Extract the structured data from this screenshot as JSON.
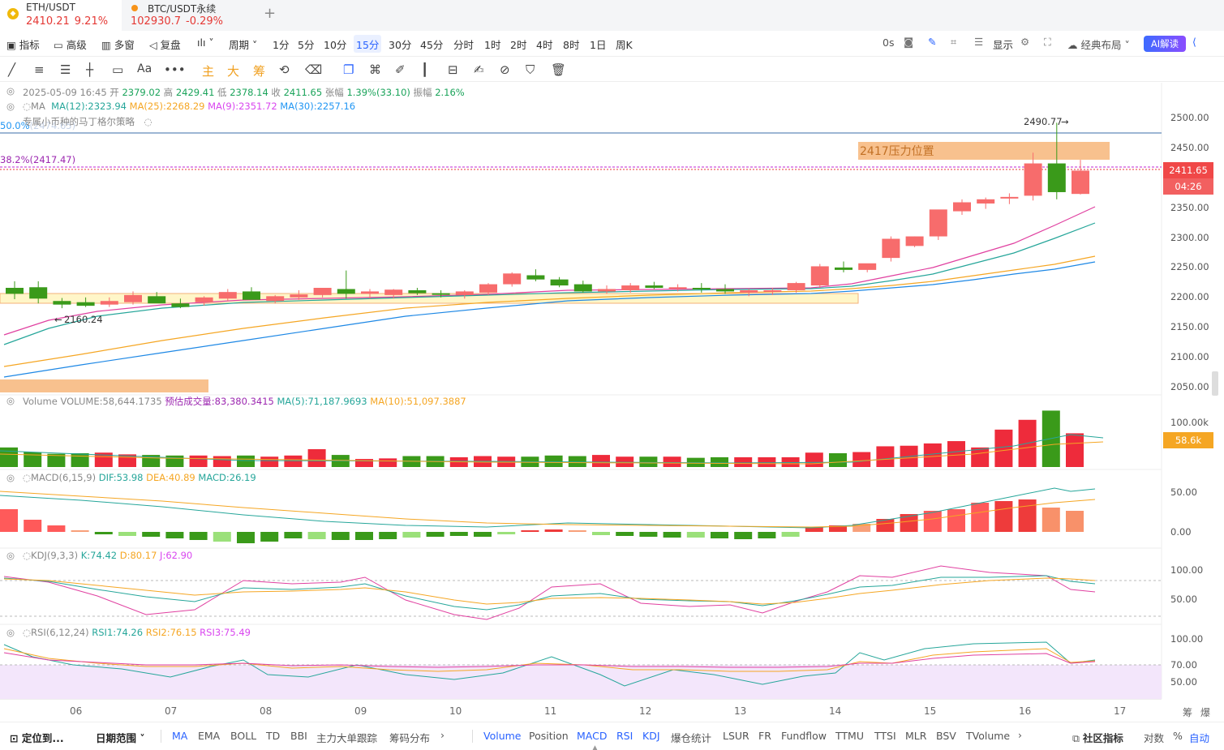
{
  "tabs": [
    {
      "symbol": "ETH/USDT",
      "price": "2410.21",
      "change": "9.21%",
      "active": true
    },
    {
      "symbol": "BTC/USDT永续",
      "price": "102930.7",
      "change": "-0.29%",
      "active": false
    }
  ],
  "toolbar": {
    "indicators": "指标",
    "advanced": "高级",
    "multi_window": "多窗",
    "replay": "复盘",
    "period": "周期",
    "intervals": [
      "1分",
      "5分",
      "10分",
      "15分",
      "30分",
      "45分",
      "分时",
      "1时",
      "2时",
      "4时",
      "8时",
      "1日",
      "周K"
    ],
    "selected_interval": "15分",
    "countdown": "0s",
    "display": "显示",
    "layout": "经典布局",
    "ai_read": "AI解读"
  },
  "draw_tools": {
    "main": "主",
    "big": "大",
    "chips": "筹",
    "text": "Aa"
  },
  "ohlc": {
    "datetime": "2025-05-09 16:45",
    "open_label": "开",
    "open": "2379.02",
    "high_label": "高",
    "high": "2429.41",
    "low_label": "低",
    "low": "2378.14",
    "close_label": "收",
    "close": "2411.65",
    "chg_label": "张幅",
    "chg": "1.39%(33.10)",
    "amp_label": "振幅",
    "amp": "2.16%"
  },
  "ma_legend": {
    "name": "MA",
    "ma12": "MA(12):2323.94",
    "ma25": "MA(25):2268.29",
    "ma9": "MA(9):2351.72",
    "ma30": "MA(30):2257.16"
  },
  "strategy": {
    "name": "专属小币种的马丁格尔策略",
    "fib50": "50.0%",
    "fib50_value": "(2474.65)",
    "fib382": "38.2%(2417.47)"
  },
  "annotations": {
    "high_mark": "2490.77",
    "low_mark": "2160.24",
    "resistance": "2417压力位置"
  },
  "price_axis": [
    "2500.00",
    "2450.00",
    "2400.00",
    "2350.00",
    "2300.00",
    "2250.00",
    "2200.00",
    "2150.00",
    "2100.00",
    "2050.00"
  ],
  "last_price": "2411.65",
  "countdown_tag": "04:26",
  "volume": {
    "name": "Volume",
    "value": "VOLUME:58,644.1735",
    "est": "预估成交量:83,380.3415",
    "ma5": "MA(5):71,187.9693",
    "ma10": "MA(10):51,097.3887",
    "axis": "100.00k",
    "tag": "58.6k"
  },
  "macd": {
    "name": "MACD(6,15,9)",
    "dif": "DIF:53.98",
    "dea": "DEA:40.89",
    "macd": "MACD:26.19",
    "axis": [
      "50.00",
      "0.00"
    ]
  },
  "kdj": {
    "name": "KDJ(9,3,3)",
    "k": "K:74.42",
    "d": "D:80.17",
    "j": "J:62.90",
    "axis": [
      "100.00",
      "50.00"
    ]
  },
  "rsi": {
    "name": "RSI(6,12,24)",
    "rsi1": "RSI1:74.26",
    "rsi2": "RSI2:76.15",
    "rsi3": "RSI3:75.49",
    "axis": [
      "100.00",
      "70.00",
      "50.00"
    ]
  },
  "dates": [
    "06",
    "07",
    "08",
    "09",
    "10",
    "11",
    "12",
    "13",
    "14",
    "15",
    "16",
    "17"
  ],
  "date_axis_right": [
    "筹",
    "爆"
  ],
  "bottom": {
    "locate": "定位到...",
    "range": "日期范围",
    "main_ind": [
      "MA",
      "EMA",
      "BOLL",
      "TD",
      "BBI",
      "主力大单跟踪",
      "筹码分布"
    ],
    "sub_ind": [
      "Volume",
      "Position",
      "MACD",
      "RSI",
      "KDJ",
      "爆仓统计",
      "LSUR",
      "FR",
      "Fundflow",
      "TTMU",
      "TTSI",
      "MLR",
      "BSV",
      "TVolume"
    ],
    "community": "社区指标",
    "log": "对数",
    "pct": "%",
    "auto": "自动"
  },
  "colors": {
    "up": "#f76c6c",
    "down": "#3a9a1a",
    "accent": "#2962ff"
  },
  "chart_data": {
    "type": "candlestick",
    "x_ticks": [
      "06",
      "07",
      "08",
      "09",
      "10",
      "11",
      "12",
      "13",
      "14",
      "15",
      "16",
      "17"
    ],
    "ylim": [
      2030,
      2520
    ],
    "candles": [
      [
        2214,
        2225,
        2195,
        2204
      ],
      [
        2215,
        2225,
        2188,
        2196
      ],
      [
        2192,
        2197,
        2180,
        2186
      ],
      [
        2190,
        2198,
        2182,
        2184
      ],
      [
        2186,
        2198,
        2182,
        2192
      ],
      [
        2190,
        2208,
        2186,
        2202
      ],
      [
        2200,
        2207,
        2190,
        2188
      ],
      [
        2188,
        2196,
        2180,
        2182
      ],
      [
        2190,
        2200,
        2184,
        2198
      ],
      [
        2196,
        2212,
        2192,
        2207
      ],
      [
        2208,
        2215,
        2200,
        2194
      ],
      [
        2192,
        2202,
        2188,
        2200
      ],
      [
        2198,
        2210,
        2194,
        2203
      ],
      [
        2202,
        2214,
        2198,
        2214
      ],
      [
        2212,
        2243,
        2196,
        2204
      ],
      [
        2204,
        2212,
        2196,
        2208
      ],
      [
        2202,
        2212,
        2196,
        2211
      ],
      [
        2210,
        2214,
        2202,
        2205
      ],
      [
        2205,
        2210,
        2198,
        2203
      ],
      [
        2202,
        2210,
        2196,
        2208
      ],
      [
        2206,
        2222,
        2202,
        2220
      ],
      [
        2220,
        2240,
        2216,
        2238
      ],
      [
        2235,
        2245,
        2225,
        2228
      ],
      [
        2228,
        2232,
        2215,
        2218
      ],
      [
        2220,
        2226,
        2206,
        2208
      ],
      [
        2208,
        2218,
        2204,
        2212
      ],
      [
        2210,
        2222,
        2206,
        2218
      ],
      [
        2218,
        2224,
        2212,
        2214
      ],
      [
        2213,
        2220,
        2208,
        2215
      ],
      [
        2214,
        2222,
        2206,
        2212
      ],
      [
        2212,
        2220,
        2204,
        2208
      ],
      [
        2206,
        2212,
        2200,
        2210
      ],
      [
        2208,
        2214,
        2202,
        2210
      ],
      [
        2210,
        2224,
        2206,
        2222
      ],
      [
        2218,
        2254,
        2214,
        2250
      ],
      [
        2248,
        2258,
        2240,
        2244
      ],
      [
        2244,
        2252,
        2240,
        2255
      ],
      [
        2264,
        2300,
        2258,
        2296
      ],
      [
        2284,
        2300,
        2282,
        2300
      ],
      [
        2300,
        2342,
        2294,
        2345
      ],
      [
        2342,
        2362,
        2336,
        2357
      ],
      [
        2355,
        2365,
        2346,
        2362
      ],
      [
        2366,
        2372,
        2354,
        2366
      ],
      [
        2368,
        2440,
        2360,
        2422
      ],
      [
        2422,
        2490,
        2362,
        2374
      ],
      [
        2371,
        2428,
        2370,
        2410
      ]
    ],
    "volume_k": [
      34,
      26,
      23,
      24,
      25,
      22,
      21,
      20,
      20,
      19,
      20,
      18,
      20,
      31,
      21,
      14,
      15,
      19,
      19,
      17,
      19,
      18,
      18,
      20,
      19,
      21,
      18,
      18,
      18,
      16,
      17,
      17,
      17,
      17,
      25,
      24,
      26,
      36,
      37,
      41,
      45,
      34,
      65,
      82,
      98,
      58.6
    ]
  }
}
